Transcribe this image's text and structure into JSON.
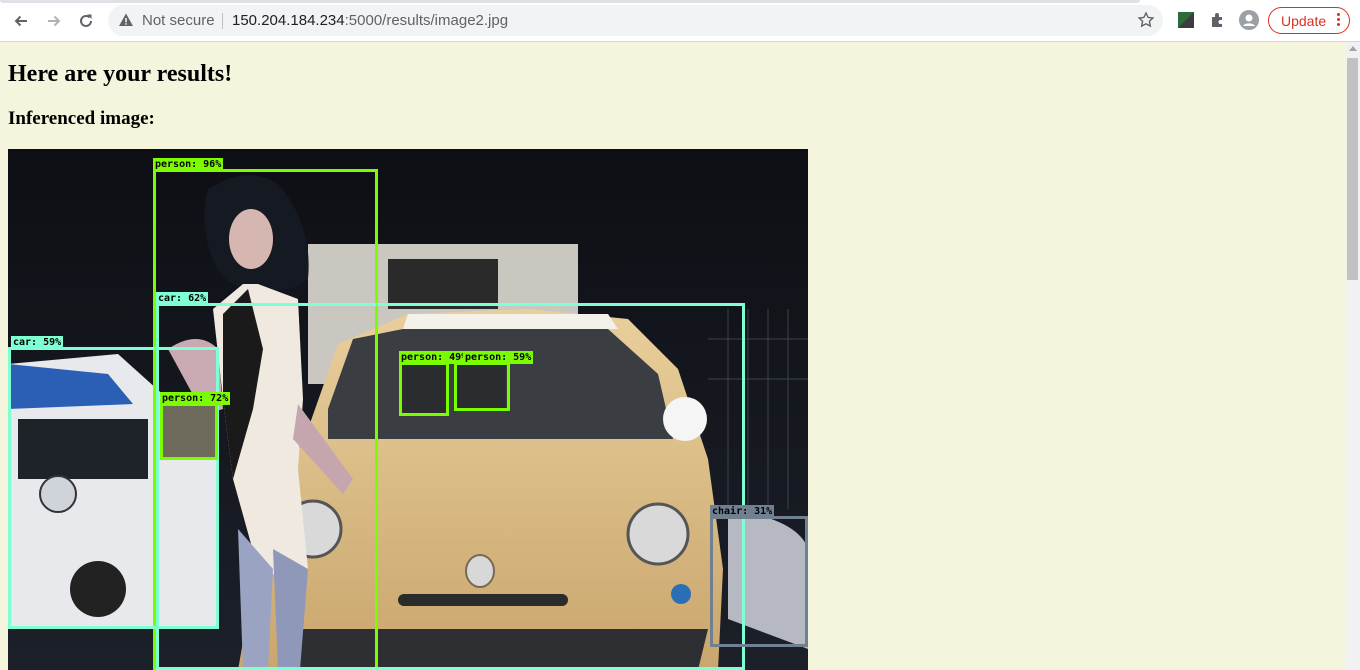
{
  "browser": {
    "security_label": "Not secure",
    "url_host": "150.204.184.234",
    "url_path": ":5000/results/image2.jpg",
    "update_label": "Update"
  },
  "page": {
    "heading": "Here are your results!",
    "subheading": "Inferenced image:"
  },
  "detections": [
    {
      "label": "person:  96%",
      "color": "#7cfc00"
    },
    {
      "label": "car:  62%",
      "color": "#7fffd4"
    },
    {
      "label": "car:  59%",
      "color": "#7fffd4"
    },
    {
      "label": "person:  72%",
      "color": "#7cfc00"
    },
    {
      "label": "person:  49%",
      "color": "#7cfc00"
    },
    {
      "label": "person:  59%",
      "color": "#7cfc00"
    },
    {
      "label": "chair:  31%",
      "color": "#708090"
    }
  ]
}
